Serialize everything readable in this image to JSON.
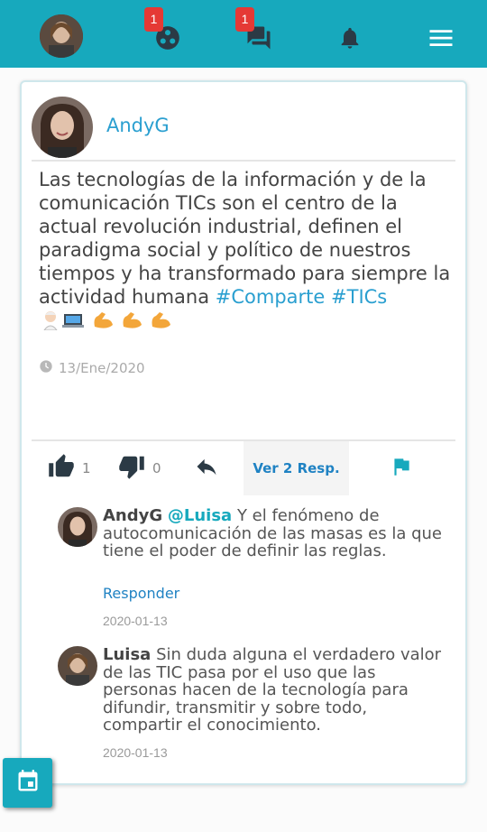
{
  "colors": {
    "primary": "#17a9bd",
    "badge": "#e53935",
    "link": "#2a9fd0"
  },
  "topbar": {
    "icons": [
      "avatar",
      "groups-icon",
      "chat-icon",
      "bell-icon",
      "menu-icon"
    ],
    "groups_badge": "1",
    "chat_badge": "1"
  },
  "post": {
    "author": "AndyG",
    "text": "Las tecnologías de la información y de la comunicación TICs son el centro de la actual revolución industrial, definen el paradigma social y político de nuestros tiempos y ha transformado para siempre la actividad humana",
    "hashtags": [
      "#Comparte",
      "#TICs"
    ],
    "date": "13/Ene/2020",
    "likes": "1",
    "dislikes": "0",
    "view_replies_label": "Ver 2 Resp."
  },
  "comments": [
    {
      "author": "AndyG",
      "mention": "@Luisa",
      "text": "Y el fenómeno de autocomunicación de las masas es la que tiene el poder de definir las reglas.",
      "reply_label": "Responder",
      "date": "2020-01-13"
    },
    {
      "author": "Luisa",
      "text": "Sin duda alguna el verdadero valor de las TIC pasa por el uso que las personas hacen de la tecnología para difundir, transmitir y sobre todo, compartir el conocimiento.",
      "date": "2020-01-13"
    }
  ]
}
